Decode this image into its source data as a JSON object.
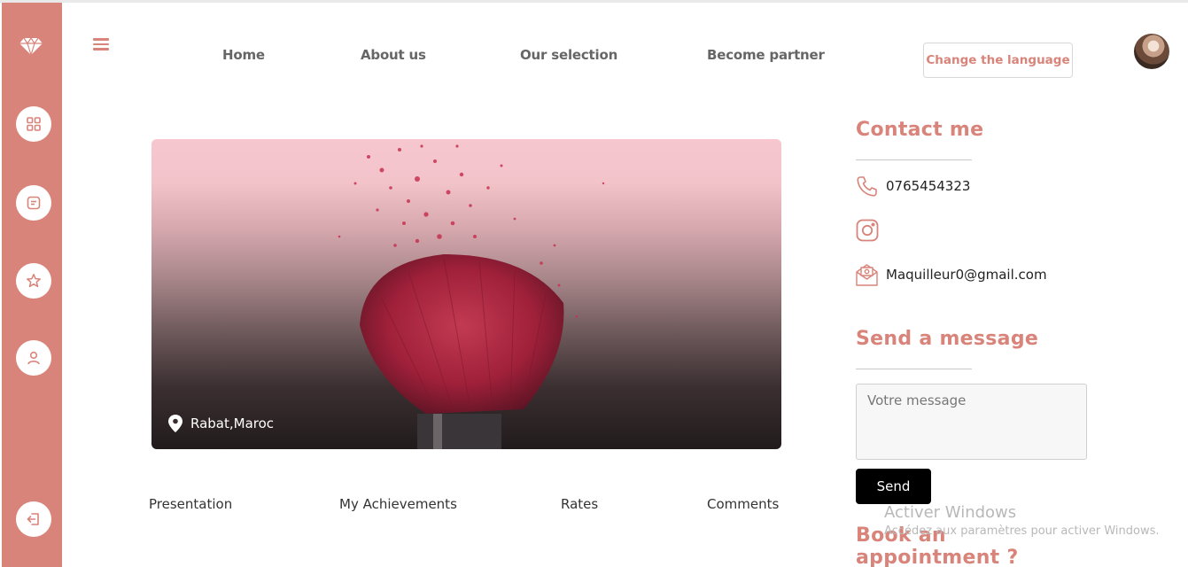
{
  "nav": {
    "items": [
      "Home",
      "About us",
      "Our selection",
      "Become partner"
    ],
    "language_button": "Change the language"
  },
  "sidebar": {
    "icons": [
      "diamond-logo-icon",
      "grid-icon",
      "note-icon",
      "star-icon",
      "user-icon",
      "logout-icon"
    ]
  },
  "hero": {
    "location": "Rabat,Maroc"
  },
  "tabs": [
    "Presentation",
    "My Achievements",
    "Rates",
    "Comments"
  ],
  "contact": {
    "title": "Contact me",
    "phone": "0765454323",
    "email": "Maquilleur0@gmail.com"
  },
  "message": {
    "title": "Send a message",
    "placeholder": "Votre message",
    "send_label": "Send"
  },
  "appointment": {
    "title": "Book an appointment ?"
  },
  "windows_watermark": {
    "line1": "Activer Windows",
    "line2": "Accédez aux paramètres pour activer Windows."
  },
  "colors": {
    "accent": "#d9847a",
    "sidebar": "#d9847a",
    "button_dark": "#000000"
  }
}
